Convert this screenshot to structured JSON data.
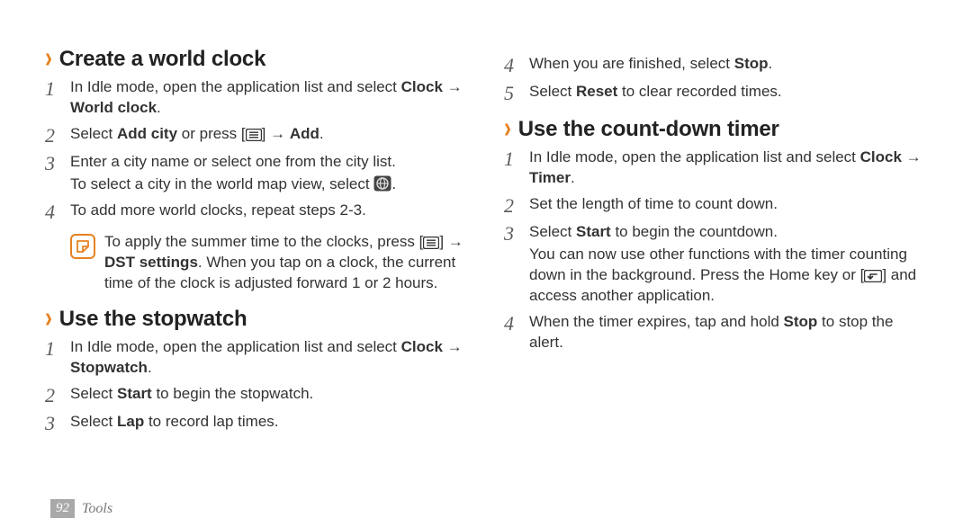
{
  "footer": {
    "page": "92",
    "section": "Tools"
  },
  "sections": {
    "world_clock": {
      "title": "Create a world clock",
      "step1_a": "In Idle mode, open the application list and select ",
      "step1_b": "Clock → World clock",
      "step1_c": ".",
      "step2_a": "Select ",
      "step2_b": "Add city",
      "step2_c": " or press [",
      "step2_d": "] → ",
      "step2_e": "Add",
      "step2_f": ".",
      "step3_a": "Enter a city name or select one from the city list.",
      "step3_b_a": "To select a city in the world map view, select ",
      "step3_b_c": ".",
      "step4": "To add more world clocks, repeat steps 2-3.",
      "note_a": "To apply the summer time to the clocks, press [",
      "note_b": "] → ",
      "note_c": "DST settings",
      "note_d": ". When you tap on a clock, the current time of the clock is adjusted forward 1 or 2 hours."
    },
    "stopwatch": {
      "title": "Use the stopwatch",
      "step1_a": "In Idle mode, open the application list and select ",
      "step1_b": "Clock → Stopwatch",
      "step1_c": ".",
      "step2_a": "Select ",
      "step2_b": "Start",
      "step2_c": " to begin the stopwatch.",
      "step3_a": "Select ",
      "step3_b": "Lap",
      "step3_c": " to record lap times.",
      "step4_a": "When you are finished, select ",
      "step4_b": "Stop",
      "step4_c": ".",
      "step5_a": "Select ",
      "step5_b": "Reset",
      "step5_c": " to clear recorded times."
    },
    "timer": {
      "title": "Use the count-down timer",
      "step1_a": "In Idle mode, open the application list and select ",
      "step1_b": "Clock → Timer",
      "step1_c": ".",
      "step2": "Set the length of time to count down.",
      "step3_a": "Select ",
      "step3_b": "Start",
      "step3_c": " to begin the countdown.",
      "step3_sub_a": "You can now use other functions with the timer counting down in the background. Press the Home key or [",
      "step3_sub_b": "] and access another application.",
      "step4_a": "When the timer expires, tap and hold ",
      "step4_b": "Stop",
      "step4_c": " to stop the alert."
    }
  }
}
